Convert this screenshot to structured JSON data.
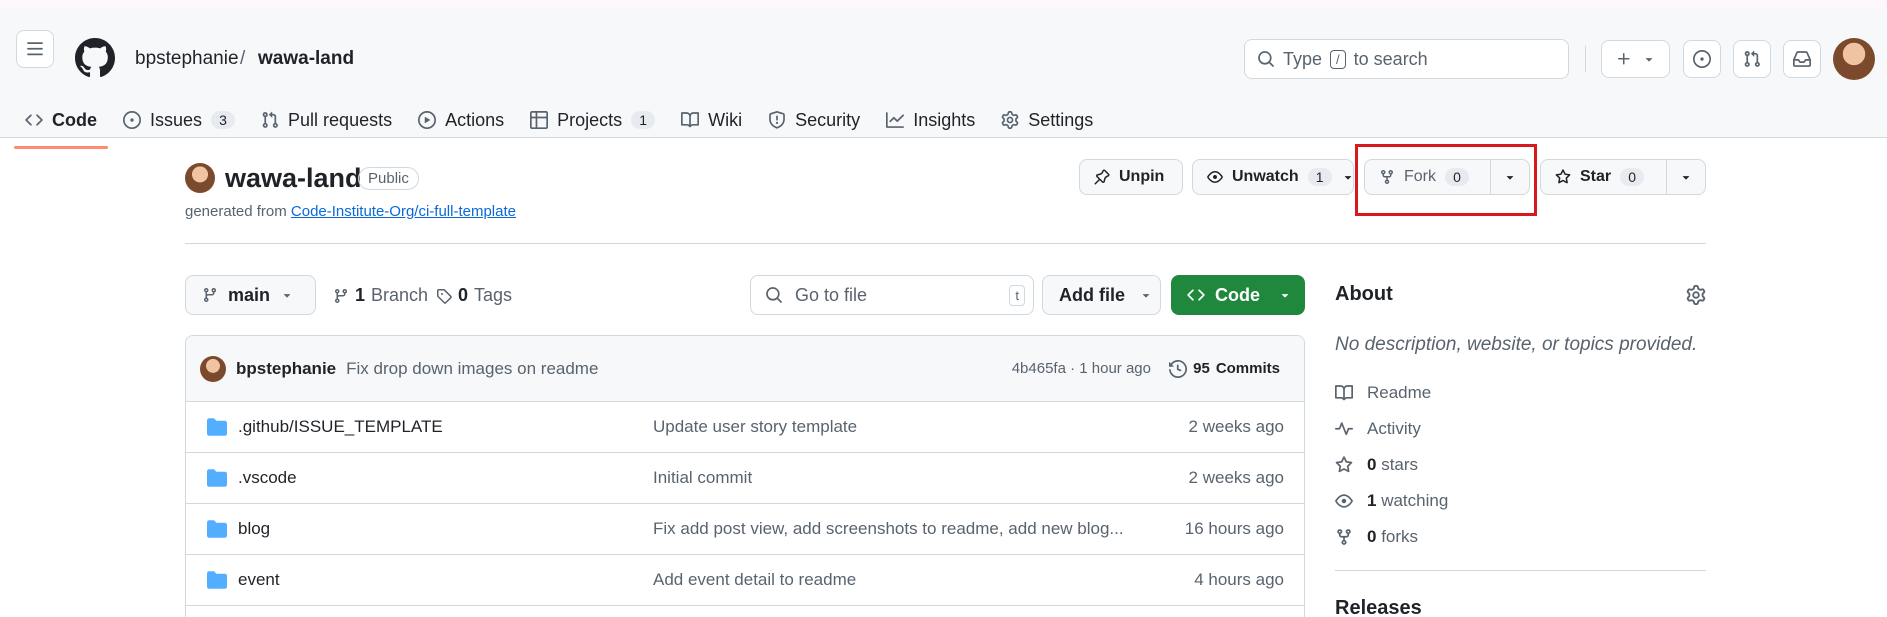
{
  "header": {
    "owner": "bpstephanie",
    "separator": "/",
    "repo": "wawa-land",
    "search": {
      "text_before": "Type",
      "key": "/",
      "text_after": "to search"
    }
  },
  "tabs": [
    {
      "label": "Code",
      "icon": "code-icon",
      "count": null,
      "active": true
    },
    {
      "label": "Issues",
      "icon": "issue-opened-icon",
      "count": "3"
    },
    {
      "label": "Pull requests",
      "icon": "git-pull-request-icon",
      "count": null
    },
    {
      "label": "Actions",
      "icon": "play-icon",
      "count": null
    },
    {
      "label": "Projects",
      "icon": "table-icon",
      "count": "1"
    },
    {
      "label": "Wiki",
      "icon": "book-icon",
      "count": null
    },
    {
      "label": "Security",
      "icon": "shield-icon",
      "count": null
    },
    {
      "label": "Insights",
      "icon": "graph-icon",
      "count": null
    },
    {
      "label": "Settings",
      "icon": "gear-icon",
      "count": null
    }
  ],
  "repo": {
    "name": "wawa-land",
    "visibility": "Public",
    "generated_from_text": "generated from",
    "template_link": "Code-Institute-Org/ci-full-template",
    "actions": {
      "unpin": "Unpin",
      "unwatch": "Unwatch",
      "watch_count": "1",
      "fork": "Fork",
      "fork_count": "0",
      "star": "Star",
      "star_count": "0"
    }
  },
  "toolbar": {
    "branch": "main",
    "branches_count": "1",
    "branches_label": "Branch",
    "tags_count": "0",
    "tags_label": "Tags",
    "goto_placeholder": "Go to file",
    "goto_key": "t",
    "add_file": "Add file",
    "code": "Code"
  },
  "commit": {
    "author": "bpstephanie",
    "message": "Fix drop down images on readme",
    "hash_time": "4b465fa · 1 hour ago",
    "commits_count": "95",
    "commits_label": "Commits"
  },
  "files": [
    {
      "name": ".github/ISSUE_TEMPLATE",
      "message": "Update user story template",
      "date": "2 weeks ago"
    },
    {
      "name": ".vscode",
      "message": "Initial commit",
      "date": "2 weeks ago"
    },
    {
      "name": "blog",
      "message": "Fix add post view, add screenshots to readme, add new blog...",
      "date": "16 hours ago"
    },
    {
      "name": "event",
      "message": "Add event detail to readme",
      "date": "4 hours ago"
    }
  ],
  "about": {
    "title": "About",
    "description": "No description, website, or topics provided.",
    "readme": "Readme",
    "activity": "Activity",
    "stars_count": "0",
    "stars_label": "stars",
    "watching_count": "1",
    "watching_label": "watching",
    "forks_count": "0",
    "forks_label": "forks",
    "releases": "Releases"
  },
  "colors": {
    "accent_tab": "#fd8c73",
    "code_button": "#1f883d",
    "link": "#0969da",
    "folder": "#54aeff",
    "highlight_box": "#d7191c"
  }
}
